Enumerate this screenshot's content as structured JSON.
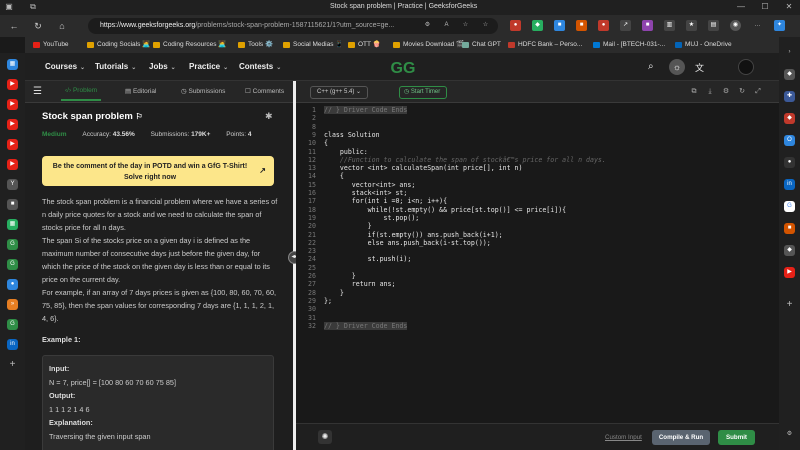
{
  "window": {
    "title": "Stock span problem | Practice | GeeksforGeeks",
    "controls": [
      "minimize",
      "maximize",
      "close"
    ]
  },
  "browser": {
    "url_host": "https://www.geeksforgeeks.org",
    "url_path": "/problems/stock-span-problem-1587115621/1?utm_source=ge..."
  },
  "bookmarks": [
    {
      "label": "YouTube",
      "color": "#e62117"
    },
    {
      "label": "Coding Socials 🧑‍💻",
      "color": "#e0a100"
    },
    {
      "label": "Coding Resources 🧑‍💻",
      "color": "#e0a100"
    },
    {
      "label": "Tools ⚙️",
      "color": "#e0a100"
    },
    {
      "label": "Social Medias 📱",
      "color": "#e0a100"
    },
    {
      "label": "OTT 🍿",
      "color": "#e0a100"
    },
    {
      "label": "Movies Download 🎬",
      "color": "#e0a100"
    },
    {
      "label": "Chat GPT",
      "color": "#74aa9c"
    },
    {
      "label": "HDFC Bank – Perso...",
      "color": "#c0392b"
    },
    {
      "label": "Mail - [BTECH-031-...",
      "color": "#0078d4"
    },
    {
      "label": "MUJ - OneDrive",
      "color": "#0364b8"
    }
  ],
  "gfg": {
    "menus": [
      "Courses",
      "Tutorials",
      "Jobs",
      "Practice",
      "Contests"
    ],
    "logo_text": "GG"
  },
  "problem_tabs": [
    "Problem",
    "Editorial",
    "Submissions",
    "Comments"
  ],
  "problem": {
    "title": "Stock span problem",
    "difficulty": "Medium",
    "accuracy_label": "Accuracy:",
    "accuracy": "43.56%",
    "submissions_label": "Submissions:",
    "submissions": "179K+",
    "points_label": "Points:",
    "points": "4",
    "potd": "Be the comment of the day in POTD and win a GfG T-Shirt! Solve right now",
    "para1": "The stock span problem is a financial problem where we have a series of n daily price quotes for a stock and we need to calculate the span of stocks price for all n days.",
    "para2": "The span Si of the stocks price on a given day i is defined as the maximum number of consecutive days just before the given day, for which the price of the stock on the given day is less than or equal to its price on the current day.",
    "para3": "For example, if an array of 7 days prices is given as {100, 80, 60, 70, 60, 75, 85}, then the span values for corresponding 7 days are {1, 1, 1, 2, 1, 4, 6}.",
    "example_heading": "Example 1:",
    "input_label": "Input:",
    "input_value": "N = 7, price[] = [100 80 60 70 60 75 85]",
    "output_label": "Output:",
    "output_value": "1 1 1 2 1 4 6",
    "explanation_label": "Explanation:",
    "explanation_value": "Traversing  the  given  input  span"
  },
  "editor": {
    "language": "C++ (g++ 5.4)",
    "timer": "Start Timer",
    "lines": [
      {
        "n": "1",
        "t": "// } Driver Code Ends",
        "c": "fold"
      },
      {
        "n": "2",
        "t": "",
        "c": ""
      },
      {
        "n": "8",
        "t": "",
        "c": ""
      },
      {
        "n": "9",
        "t": "class Solution",
        "c": ""
      },
      {
        "n": "10",
        "t": "{",
        "c": ""
      },
      {
        "n": "11",
        "t": "    public:",
        "c": ""
      },
      {
        "n": "12",
        "t": "    //Function to calculate the span of stockâ€™s price for all n days.",
        "c": "cm"
      },
      {
        "n": "13",
        "t": "    vector <int> calculateSpan(int price[], int n)",
        "c": ""
      },
      {
        "n": "14",
        "t": "    {",
        "c": ""
      },
      {
        "n": "15",
        "t": "       vector<int> ans;",
        "c": ""
      },
      {
        "n": "16",
        "t": "       stack<int> st;",
        "c": ""
      },
      {
        "n": "17",
        "t": "       for(int i =0; i<n; i++){",
        "c": ""
      },
      {
        "n": "18",
        "t": "           while(!st.empty() && price[st.top()] <= price[i]){",
        "c": ""
      },
      {
        "n": "19",
        "t": "               st.pop();",
        "c": ""
      },
      {
        "n": "20",
        "t": "           }",
        "c": ""
      },
      {
        "n": "21",
        "t": "           if(st.empty()) ans.push_back(i+1);",
        "c": ""
      },
      {
        "n": "22",
        "t": "           else ans.push_back(i-st.top());",
        "c": ""
      },
      {
        "n": "23",
        "t": "",
        "c": ""
      },
      {
        "n": "24",
        "t": "           st.push(i);",
        "c": ""
      },
      {
        "n": "25",
        "t": "",
        "c": ""
      },
      {
        "n": "26",
        "t": "       }",
        "c": ""
      },
      {
        "n": "27",
        "t": "       return ans;",
        "c": ""
      },
      {
        "n": "28",
        "t": "    }",
        "c": ""
      },
      {
        "n": "29",
        "t": "};",
        "c": ""
      },
      {
        "n": "30",
        "t": "",
        "c": ""
      },
      {
        "n": "31",
        "t": "",
        "c": ""
      },
      {
        "n": "32",
        "t": "// } Driver Code Ends",
        "c": "fold"
      }
    ]
  },
  "footer": {
    "custom_input": "Custom Input",
    "compile_run": "Compile & Run",
    "submit": "Submit"
  }
}
